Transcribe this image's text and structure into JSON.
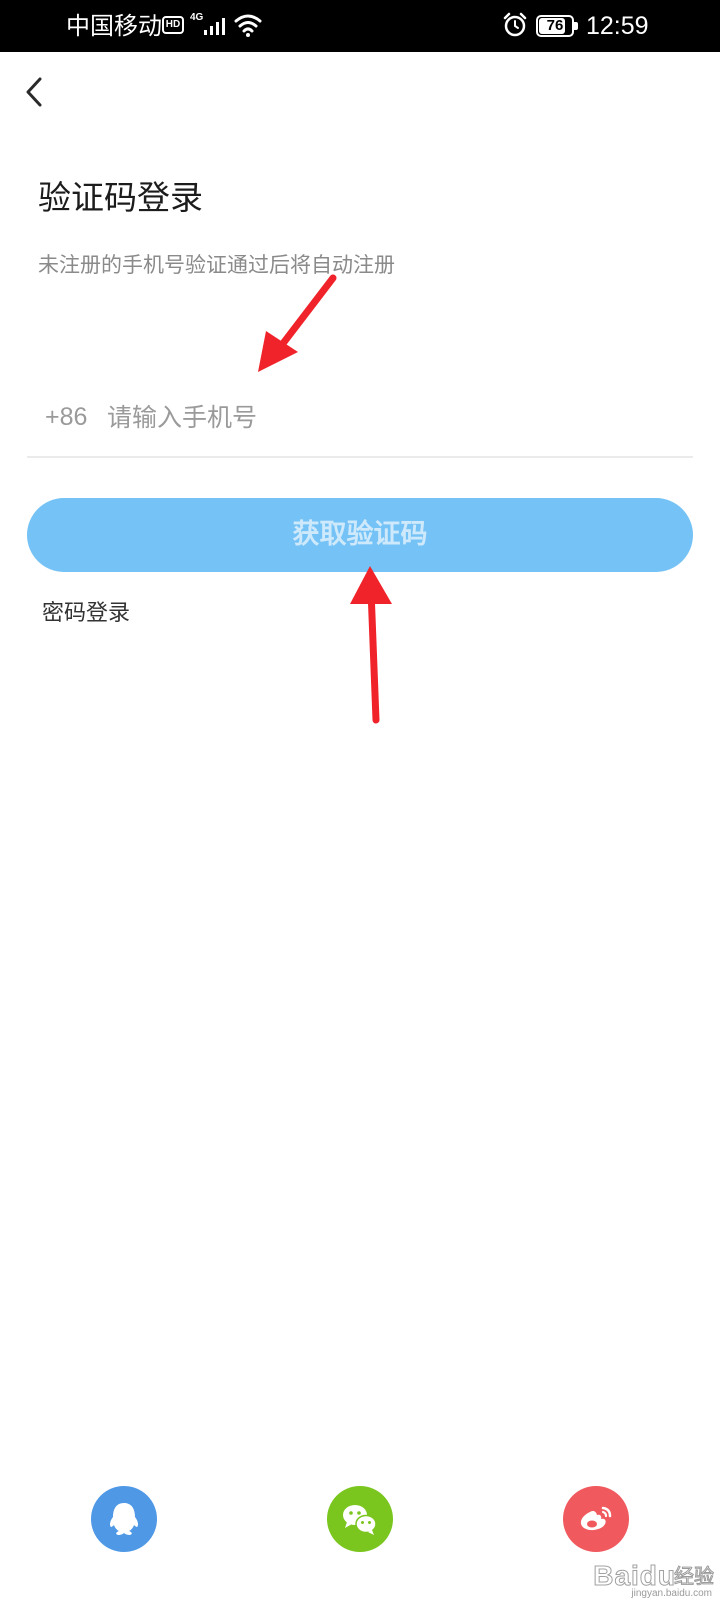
{
  "status_bar": {
    "carrier": "中国移动",
    "hd_badge": "HD",
    "network_type": "4G",
    "battery_level": "76",
    "battery_fraction": 0.76,
    "time": "12:59"
  },
  "header": {
    "back_icon": "chevron-left-icon"
  },
  "login": {
    "title": "验证码登录",
    "subtitle": "未注册的手机号验证通过后将自动注册",
    "country_code": "+86",
    "phone_placeholder": "请输入手机号",
    "phone_value": "",
    "get_code_label": "获取验证码",
    "password_login_label": "密码登录"
  },
  "social_login": [
    {
      "name": "qq",
      "icon": "qq-penguin-icon",
      "color": "#4e98e6"
    },
    {
      "name": "wechat",
      "icon": "wechat-icon",
      "color": "#7ac61e"
    },
    {
      "name": "weibo",
      "icon": "weibo-icon",
      "color": "#f05a5e"
    }
  ],
  "watermark": {
    "brand": "Baidu",
    "brand_cn": "经验",
    "url": "jingyan.baidu.com"
  },
  "colors": {
    "button_bg": "#74c2f6",
    "annotation_arrow": "#f0232a"
  }
}
